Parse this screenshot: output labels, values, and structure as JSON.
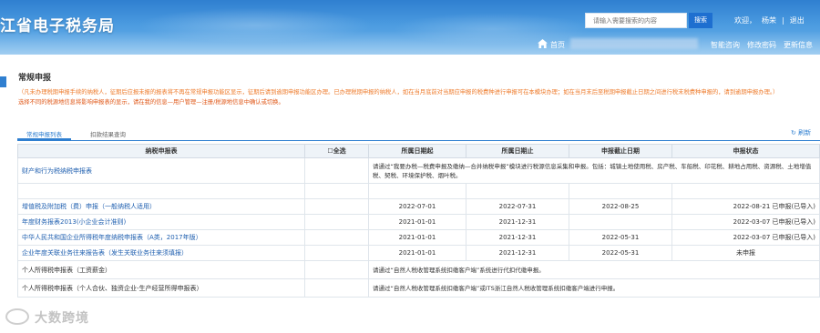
{
  "header": {
    "site_title": "江省电子税务局",
    "search_placeholder": "请输入需要搜索的内容",
    "search_button": "搜索",
    "welcome": "欢迎，",
    "user_name": "杨荣",
    "logout": "退出",
    "nav_home": "首页",
    "nav_help": "智能咨询",
    "nav_password": "修改密码",
    "nav_update": "更新信息"
  },
  "page": {
    "title": "常规申报",
    "notice": "（凡未办理税期申报手续的纳税人，征期后应报未报的报表将不再在常规申报功能区显示，征期后请到逾期申报功能区办理。已办理税期申报的纳税人，如在当月底前对当期应申报的税费种进行申报可在本模块办理；如在当月末后至税期申报截止日期之间进行税末税费种申报的，请到逾期申报办理。）",
    "notice2": "选择不同的税源地信息将影响申报表的显示，请在我的信息—用户管理—注册/税源地信息中确认或切换。"
  },
  "tabs": {
    "active": "常规申报列表",
    "inactive": "扣款结果查询",
    "refresh": "刷新"
  },
  "table": {
    "headers": {
      "name": "纳税申报表",
      "select_all": "全选",
      "period_start": "所属日期起",
      "period_end": "所属日期止",
      "deadline": "申报截止日期",
      "status": "申报状态"
    },
    "rows": [
      {
        "name": "财产和行为税纳税申报表",
        "desc": "请通过“我要办税—税费申报及缴纳—合并纳税申报”模块进行税源信息采集和申报。包括：城镇土地使用税、房产税、车船税、印花税、耕地占用税、资源税、土地增值税、契税、环境保护税、烟叶税。"
      },
      {
        "name": "增值税及附加税（费）申报（一般纳税人适用）",
        "start": "2022-07-01",
        "end": "2022-07-31",
        "deadline": "2022-08-25",
        "status": "2022-08-21 已申报(已导入)"
      },
      {
        "name": "年度财务报表2013(小企业会计准则)",
        "start": "2021-01-01",
        "end": "2021-12-31",
        "deadline": "",
        "status": "2022-03-07 已申报(已导入)"
      },
      {
        "name": "中华人民共和国企业所得税年度纳税申报表（A类，2017年版）",
        "start": "2021-01-01",
        "end": "2021-12-31",
        "deadline": "2022-05-31",
        "status": "2022-03-07 已申报(已导入)"
      },
      {
        "name": "企业年度关联业务往来报告表（发生关联业务往来须填报）",
        "start": "2021-01-01",
        "end": "2021-12-31",
        "deadline": "2022-05-31",
        "status": "未申报"
      },
      {
        "name": "个人所得税申报表（工资薪金）",
        "desc": "请通过“自然人税收管理系统扣缴客户端”系统进行代扣代缴申报。"
      },
      {
        "name": "个人所得税申报表（个人合伙、独资企业-生产经营所得申报表）",
        "desc": "请通过“自然人税收管理系统扣缴客户端”或ITS浙江自然人税收管理系统扣缴客户端进行申报。"
      }
    ]
  },
  "watermark": "大数跨境",
  "colors": {
    "primary": "#2f7fd0",
    "notice": "#ee7a2a",
    "link": "#2060b0"
  }
}
